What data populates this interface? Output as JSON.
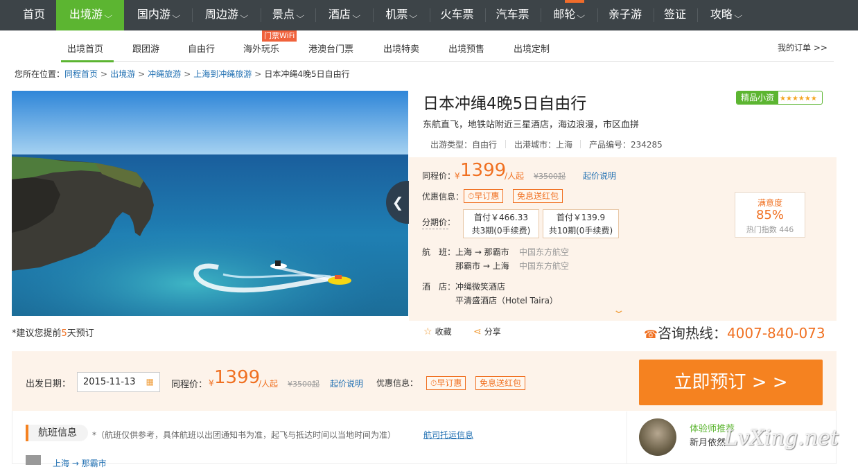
{
  "top_nav": {
    "items": [
      {
        "label": "首页",
        "dropdown": false
      },
      {
        "label": "出境游",
        "dropdown": true,
        "active": true
      },
      {
        "label": "国内游",
        "dropdown": true
      },
      {
        "label": "周边游",
        "dropdown": true
      },
      {
        "label": "景点",
        "dropdown": true
      },
      {
        "label": "酒店",
        "dropdown": true
      },
      {
        "label": "机票",
        "dropdown": true
      },
      {
        "label": "火车票",
        "dropdown": false
      },
      {
        "label": "汽车票",
        "dropdown": false
      },
      {
        "label": "邮轮",
        "dropdown": true,
        "hot": true
      },
      {
        "label": "亲子游",
        "dropdown": false
      },
      {
        "label": "签证",
        "dropdown": false
      },
      {
        "label": "攻略",
        "dropdown": true
      }
    ],
    "chevron": "⌵"
  },
  "sub_nav": {
    "items": [
      "出境首页",
      "跟团游",
      "自由行",
      "海外玩乐",
      "港澳台门票",
      "出境特卖",
      "出境预售",
      "出境定制"
    ],
    "wifi_badge": "门票WiFi",
    "orders": "我的订单 >>"
  },
  "breadcrumb": {
    "prefix": "您所在位置：",
    "items": [
      "同程首页",
      "出境游",
      "冲绳旅游",
      "上海到冲绳旅游"
    ],
    "current": "日本冲绳4晚5日自由行",
    "sep": ">"
  },
  "product": {
    "title": "日本冲绳4晚5日自由行",
    "badge_label": "精品小资",
    "badge_stars": "★★★★★★",
    "subtitle": "东航直飞，地铁站附近三星酒店，海边浪漫，市区血拼",
    "meta": [
      "出游类型：自由行",
      "出港城市：上海",
      "产品编号：234285"
    ]
  },
  "pricing": {
    "price_label": "同程价：",
    "yen": "¥",
    "price": "1399",
    "unit": "/人起",
    "original": "¥3500起",
    "price_note_link": "起价说明",
    "promo_label": "优惠信息：",
    "promo_tags": [
      "⏱早订惠",
      "免息送红包"
    ],
    "installment_label": "分期价：",
    "installments": [
      {
        "first": "首付￥466.33",
        "terms": "共3期(0手续费)"
      },
      {
        "first": "首付￥139.9",
        "terms": "共10期(0手续费)"
      }
    ],
    "satisfaction": {
      "label": "满意度",
      "value": "85%",
      "hot": "热门指数 446"
    },
    "flight_label": "航　班：",
    "flights": [
      {
        "route": "上海 → 那霸市",
        "airline": "中国东方航空"
      },
      {
        "route": "那霸市 → 上海",
        "airline": "中国东方航空"
      }
    ],
    "hotel_label": "酒　店：",
    "hotels": [
      "冲绳微笑酒店",
      "平清盛酒店（Hotel Taira）"
    ],
    "more_icon": "⌄"
  },
  "actions": {
    "tip_prefix": "*建议您提前",
    "tip_days": "5",
    "tip_suffix": "天预订",
    "favorite": "收藏",
    "share": "分享",
    "hotline_label": "咨询热线：",
    "hotline": "4007-840-073"
  },
  "booking": {
    "date_label": "出发日期：",
    "date": "2015-11-13",
    "price_label": "同程价：",
    "yen": "¥",
    "price": "1399",
    "unit": "/人起",
    "original": "¥3500起",
    "note_link": "起价说明",
    "promo_label": "优惠信息：",
    "promo_tags": [
      "⏱早订惠",
      "免息送红包"
    ],
    "book_button": "立即预订 > >"
  },
  "flight_section": {
    "title": "航班信息",
    "note": "*（航班仅供参考，具体航班以出团通知书为准，起飞与抵达时间以当地时间为准）",
    "link": "航司托运信息",
    "partial_row": "上海 → 那霸市"
  },
  "recommender": {
    "label": "体验师推荐",
    "name": "新月依然"
  },
  "watermark": "LvXing.net",
  "colors": {
    "green": "#5cb531",
    "orange": "#f07021",
    "nav_bg": "#3d4448",
    "price_bg": "#fdf3ea"
  }
}
